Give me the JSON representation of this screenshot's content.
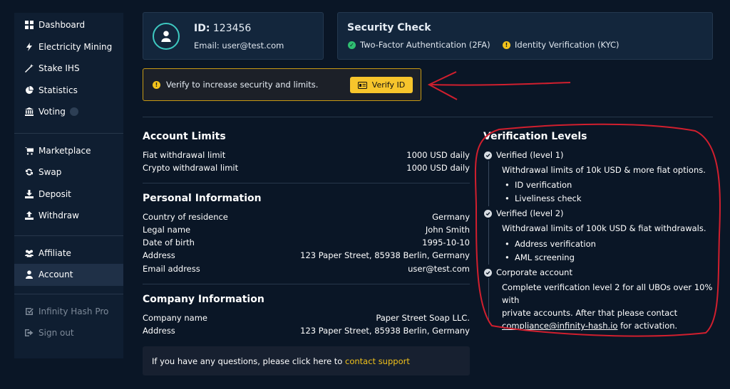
{
  "sidebar": {
    "group1": [
      {
        "label": "Dashboard",
        "icon": "dashboard-icon"
      },
      {
        "label": "Electricity Mining",
        "icon": "bolt-icon"
      },
      {
        "label": "Stake IHS",
        "icon": "wand-icon"
      },
      {
        "label": "Statistics",
        "icon": "pie-chart-icon"
      },
      {
        "label": "Voting",
        "icon": "bank-icon"
      }
    ],
    "group2": [
      {
        "label": "Marketplace",
        "icon": "cart-icon"
      },
      {
        "label": "Swap",
        "icon": "swap-icon"
      },
      {
        "label": "Deposit",
        "icon": "download-icon"
      },
      {
        "label": "Withdraw",
        "icon": "upload-icon"
      }
    ],
    "group3": [
      {
        "label": "Affiliate",
        "icon": "users-icon"
      },
      {
        "label": "Account",
        "icon": "user-icon",
        "active": true
      }
    ],
    "group4": [
      {
        "label": "Infinity Hash Pro",
        "icon": "checkbox-icon"
      },
      {
        "label": "Sign out",
        "icon": "sign-out-icon"
      }
    ]
  },
  "profile": {
    "id_label": "ID:",
    "id_value": "123456",
    "email": "Email: user@test.com"
  },
  "security": {
    "title": "Security Check",
    "items": [
      {
        "label": "Two-Factor Authentication (2FA)",
        "status": "ok",
        "color": "#2fbf71"
      },
      {
        "label": "Identity Verification (KYC)",
        "status": "warning",
        "color": "#f2c21b"
      }
    ]
  },
  "banner": {
    "message": "Verify to increase security and limits.",
    "button_label": "Verify ID"
  },
  "account_limits": {
    "title": "Account Limits",
    "rows": [
      {
        "label": "Fiat withdrawal limit",
        "value": "1000 USD daily"
      },
      {
        "label": "Crypto withdrawal limit",
        "value": "1000 USD daily"
      }
    ]
  },
  "personal_info": {
    "title": "Personal Information",
    "rows": [
      {
        "label": "Country of residence",
        "value": "Germany"
      },
      {
        "label": "Legal name",
        "value": "John Smith"
      },
      {
        "label": "Date of birth",
        "value": "1995-10-10"
      },
      {
        "label": "Address",
        "value": "123 Paper Street, 85938 Berlin, Germany"
      },
      {
        "label": "Email address",
        "value": "user@test.com"
      }
    ]
  },
  "company_info": {
    "title": "Company Information",
    "rows": [
      {
        "label": "Company name",
        "value": "Paper Street Soap LLC."
      },
      {
        "label": "Address",
        "value": "123 Paper Street, 85938 Berlin, Germany"
      }
    ]
  },
  "support": {
    "text": "If you have any questions, please click here to",
    "link": "contact support"
  },
  "verification": {
    "title": "Verification Levels",
    "level1": {
      "heading": "Verified (level 1)",
      "desc": "Withdrawal limits of 10k USD & more fiat options.",
      "bullets": [
        "ID verification",
        "Liveliness check"
      ]
    },
    "level2": {
      "heading": "Verified (level 2)",
      "desc": "Withdrawal limits of 100k USD & fiat withdrawals.",
      "bullets": [
        "Address verification",
        "AML screening"
      ]
    },
    "corporate": {
      "heading": "Corporate account",
      "line1": "Complete verification level 2 for all UBOs over 10% with",
      "line2": "private accounts. After that please contact",
      "email": "compliance@infinity-hash.io",
      "line3_suffix": " for activation."
    }
  },
  "colors": {
    "background": "#0a1626",
    "card": "#13263c",
    "accent_yellow": "#f7c52c",
    "accent_teal": "#3ec9c1",
    "annotation_red": "#d11f2e"
  }
}
